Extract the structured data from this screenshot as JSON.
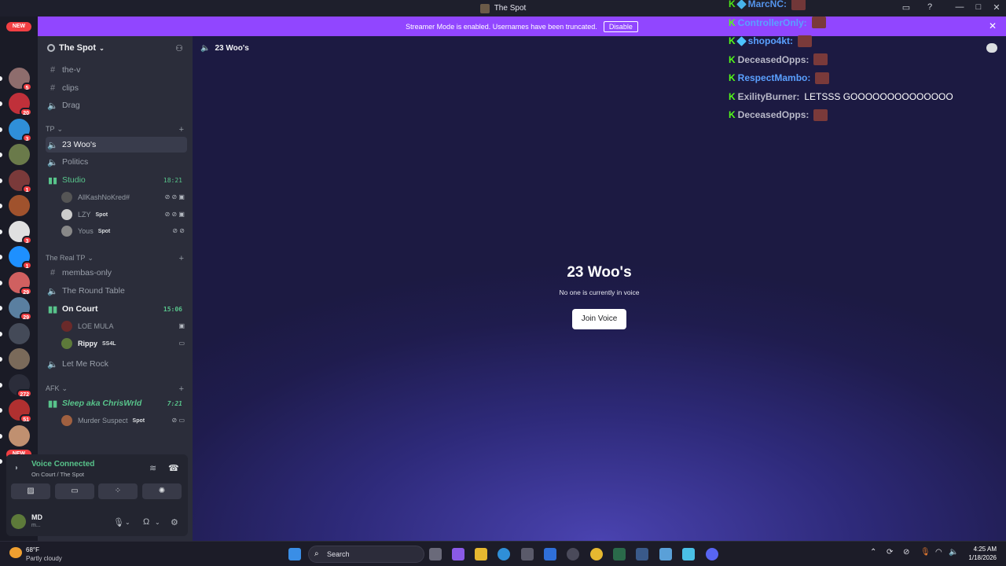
{
  "window": {
    "title": "The Spot"
  },
  "banner": {
    "text": "Streamer Mode is enabled. Usernames have been truncated.",
    "disable_label": "Disable",
    "color": "#9146ff"
  },
  "servers": [
    {
      "badge": "",
      "color": "#c0392b",
      "new": true
    },
    {
      "badge": "5",
      "color": "#8e6d6d"
    },
    {
      "badge": "20",
      "color": "#c0303a"
    },
    {
      "badge": "3",
      "color": "#2f8fd8"
    },
    {
      "badge": "",
      "color": "#6a7a4a"
    },
    {
      "badge": "1",
      "color": "#7a3a3a"
    },
    {
      "badge": "",
      "color": "#a0522d"
    },
    {
      "badge": "3",
      "color": "#e0e0e0"
    },
    {
      "badge": "1",
      "color": "#1e90ff"
    },
    {
      "badge": "29",
      "color": "#d06060"
    },
    {
      "badge": "29",
      "color": "#5a7fa0"
    },
    {
      "badge": "",
      "color": "#444a58"
    },
    {
      "badge": "",
      "color": "#7a6a5a"
    },
    {
      "badge": "272",
      "color": "#2b2d3a"
    },
    {
      "badge": "51",
      "color": "#b03030"
    },
    {
      "badge": "",
      "color": "#c09070"
    },
    {
      "badge": "",
      "color": "#d020b0",
      "new": true
    }
  ],
  "sidebar": {
    "guild_name": "The Spot",
    "top_channels": [
      {
        "icon": "#",
        "name": "the-v"
      },
      {
        "icon": "#",
        "name": "clips"
      },
      {
        "icon": "speaker",
        "name": "Drag"
      }
    ],
    "cat_tp": "TP",
    "tp_channels": [
      {
        "name": "23 Woo's",
        "selected": true
      },
      {
        "name": "Politics"
      },
      {
        "name": "Studio",
        "active": true,
        "time": "18:21"
      }
    ],
    "studio_users": [
      {
        "name": "AllKashNoKred#",
        "tag": ""
      },
      {
        "name": "LZY",
        "tag": "Spot"
      },
      {
        "name": "Yous",
        "tag": "Spot"
      }
    ],
    "cat_real_tp": "The Real TP",
    "real_tp_channels": [
      {
        "icon": "#",
        "name": "membas-only"
      },
      {
        "icon": "speaker",
        "name": "The Round Table"
      },
      {
        "icon": "live",
        "name": "On Court",
        "time": "15:06"
      }
    ],
    "court_users": [
      {
        "name": "LOE MULA",
        "tag": ""
      },
      {
        "name": "Rippy",
        "tag": "SS4L"
      }
    ],
    "let_me_rock": "Let Me Rock",
    "cat_afk": "AFK",
    "afk_channel": {
      "name": "Sleep aka ChrisWrld",
      "time": "7:21"
    },
    "afk_users": [
      {
        "name": "Murder Suspect",
        "tag": "Spot"
      }
    ]
  },
  "voice": {
    "title": "Voice Connected",
    "subtitle": "On Court / The Spot"
  },
  "user": {
    "name": "MD",
    "status": "m..."
  },
  "main": {
    "channel": "23 Woo's",
    "title": "23 Woo's",
    "subtitle": "No one is currently in voice",
    "join_label": "Join Voice"
  },
  "overlay": [
    {
      "name": "MarcNC:",
      "color": "#5aa0ff",
      "badge": true,
      "emote": true
    },
    {
      "name": "ControllerOnly:",
      "color": "#5aa0ff",
      "emote": true
    },
    {
      "name": "shopo4kt:",
      "color": "#5aa0ff",
      "badge": true,
      "emote": true
    },
    {
      "name": "DeceasedOpps:",
      "color": "#b8b8c8",
      "emote": true
    },
    {
      "name": "RespectMambo:",
      "color": "#5aa0ff",
      "emote": true
    },
    {
      "name": "ExilityBurner:",
      "color": "#b8b8c8",
      "message": "LETSSS GOOOOOOOOOOOOOO"
    },
    {
      "name": "DeceasedOpps:",
      "color": "#b8b8c8",
      "emote": true
    }
  ],
  "taskbar": {
    "temp": "68°F",
    "weather": "Partly cloudy",
    "search_placeholder": "Search",
    "time": "4:25 AM",
    "date": "1/18/2026"
  }
}
